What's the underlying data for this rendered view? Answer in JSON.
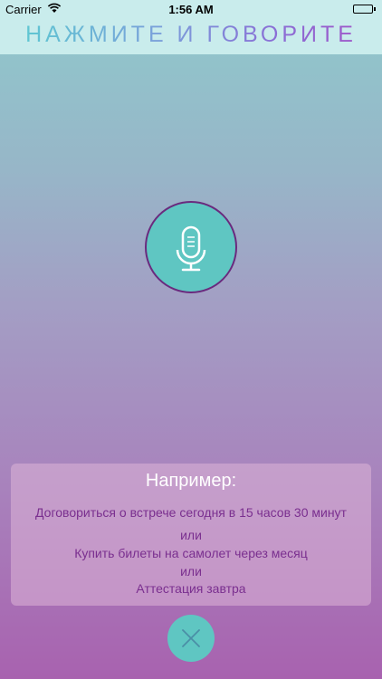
{
  "status_bar": {
    "carrier": "Carrier",
    "time": "1:56 AM",
    "wifi_icon": "wifi-icon",
    "battery_icon": "battery-icon"
  },
  "header": {
    "title": "НАЖМИТЕ И ГОВОРИТЕ"
  },
  "mic": {
    "icon": "microphone-icon"
  },
  "examples": {
    "title": "Например:",
    "line1": "Договориться о встрече сегодня в 15 часов 30 минут",
    "or1": "или",
    "line2": "Купить билеты на самолет через месяц",
    "or2": "или",
    "line3": "Аттестация завтра"
  },
  "close": {
    "icon": "close-icon"
  },
  "colors": {
    "accent": "#5fc6c2",
    "mic_border": "#6a2a7e",
    "example_text": "#7a2f8f"
  }
}
